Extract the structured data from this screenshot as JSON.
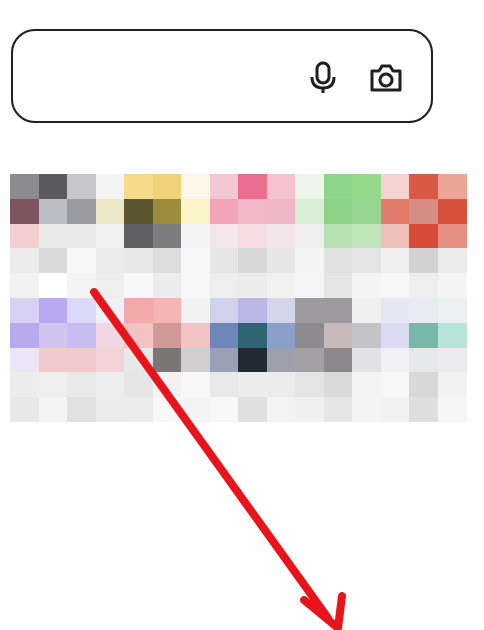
{
  "search": {
    "value": "",
    "placeholder": "",
    "mic_icon": "microphone-icon",
    "camera_icon": "camera-icon"
  },
  "colors": {
    "border": "#1f1f1f",
    "arrow": "#e8141b",
    "background": "#ffffff"
  },
  "tiles": [
    [
      "#8b8b8f",
      "#5a5a5f",
      "#c7c7cb",
      "#f3f3f3",
      "#f7d98a",
      "#f1d27b",
      "#fbf7e8",
      "#f3c7d2",
      "#e86d8e",
      "#f5c3d0",
      "#edf6ea",
      "#8fd68a",
      "#95d98c",
      "#f3d2cf",
      "#d85a46",
      "#eca497"
    ],
    [
      "#7c5560",
      "#bdbec3",
      "#9b9ca2",
      "#ece7c6",
      "#5d5430",
      "#9c8b3b",
      "#fbf4c9",
      "#f1a3b7",
      "#f2b7c6",
      "#eeb6c6",
      "#d9efd5",
      "#8dd286",
      "#96d68f",
      "#e07a6a",
      "#d58e86",
      "#d8513c"
    ],
    [
      "#f3cfcf",
      "#eaeaea",
      "#ebeaea",
      "#f2f2f2",
      "#5f5f63",
      "#7d7d81",
      "#f4f4f4",
      "#f4e7eb",
      "#f5dde3",
      "#f3e5e9",
      "#eeeeee",
      "#b5e2b0",
      "#c0e5bb",
      "#f0c1ba",
      "#d84a3a",
      "#e58f83"
    ],
    [
      "#ececec",
      "#dadada",
      "#f8f8f8",
      "#ebebeb",
      "#e8e8e8",
      "#dcdcdc",
      "#f7f7f7",
      "#e6e6e6",
      "#d8d8d8",
      "#e7e7e7",
      "#f4f4f4",
      "#e1e1e1",
      "#e4e4e4",
      "#f0f0f0",
      "#d2d2d2",
      "#ebebeb"
    ],
    [
      "#f2f2f2",
      "#ffffff",
      "#f4f4f4",
      "#eeeeee",
      "#f8f8f8",
      "#ececec",
      "#f7f7f7",
      "#eeeeee",
      "#ececec",
      "#f1f1f1",
      "#f5f5f5",
      "#e6e6e6",
      "#f4f4f4",
      "#f7f7f7",
      "#eeeeee",
      "#f4f4f4"
    ],
    [
      "#d7d2f4",
      "#b7a8f1",
      "#dcd8f7",
      "#efeff5",
      "#f2a9a9",
      "#f4b5b5",
      "#f2f2f2",
      "#cfd2ea",
      "#b9b7e6",
      "#d3d5ea",
      "#9c9a9c",
      "#9d9a9e",
      "#f0f0f0",
      "#e6e6f4",
      "#e8ecf0",
      "#eaf0f0"
    ],
    [
      "#b8a9ec",
      "#d0c5f0",
      "#c8bdf0",
      "#f0d7e3",
      "#f3c2c2",
      "#d19898",
      "#f1c3c3",
      "#6f86b8",
      "#2f6475",
      "#8aa0c8",
      "#8d8b90",
      "#c8b9bc",
      "#c3c4c7",
      "#dcd9f2",
      "#77b8ab",
      "#b9e4dc"
    ],
    [
      "#ebe5f7",
      "#f0caca",
      "#f1c9cc",
      "#f2d2d5",
      "#e8e8e8",
      "#797675",
      "#d0cece",
      "#9aa0b6",
      "#222b35",
      "#9d9faa",
      "#a3a1a4",
      "#8b878c",
      "#e2e1e3",
      "#f0f0f5",
      "#e7e8e9",
      "#ebebed"
    ],
    [
      "#ececec",
      "#eeeeee",
      "#e9e9e9",
      "#ededed",
      "#e6e6e6",
      "#f2f2f2",
      "#f7f7f7",
      "#e9e9e9",
      "#ececec",
      "#ebebeb",
      "#e4e4e4",
      "#dadada",
      "#f3f3f3",
      "#f6f6f6",
      "#d8d8d8",
      "#f1f1f1"
    ],
    [
      "#e8e8e8",
      "#f4f4f4",
      "#e1e1e1",
      "#ececec",
      "#ebebeb",
      "#f7f7f7",
      "#f4f4f4",
      "#f8f8f8",
      "#e0e0e0",
      "#f3f3f3",
      "#f0f0f0",
      "#e5e5e5",
      "#f4f4f4",
      "#f1f1f1",
      "#dedede",
      "#f5f5f5"
    ]
  ]
}
